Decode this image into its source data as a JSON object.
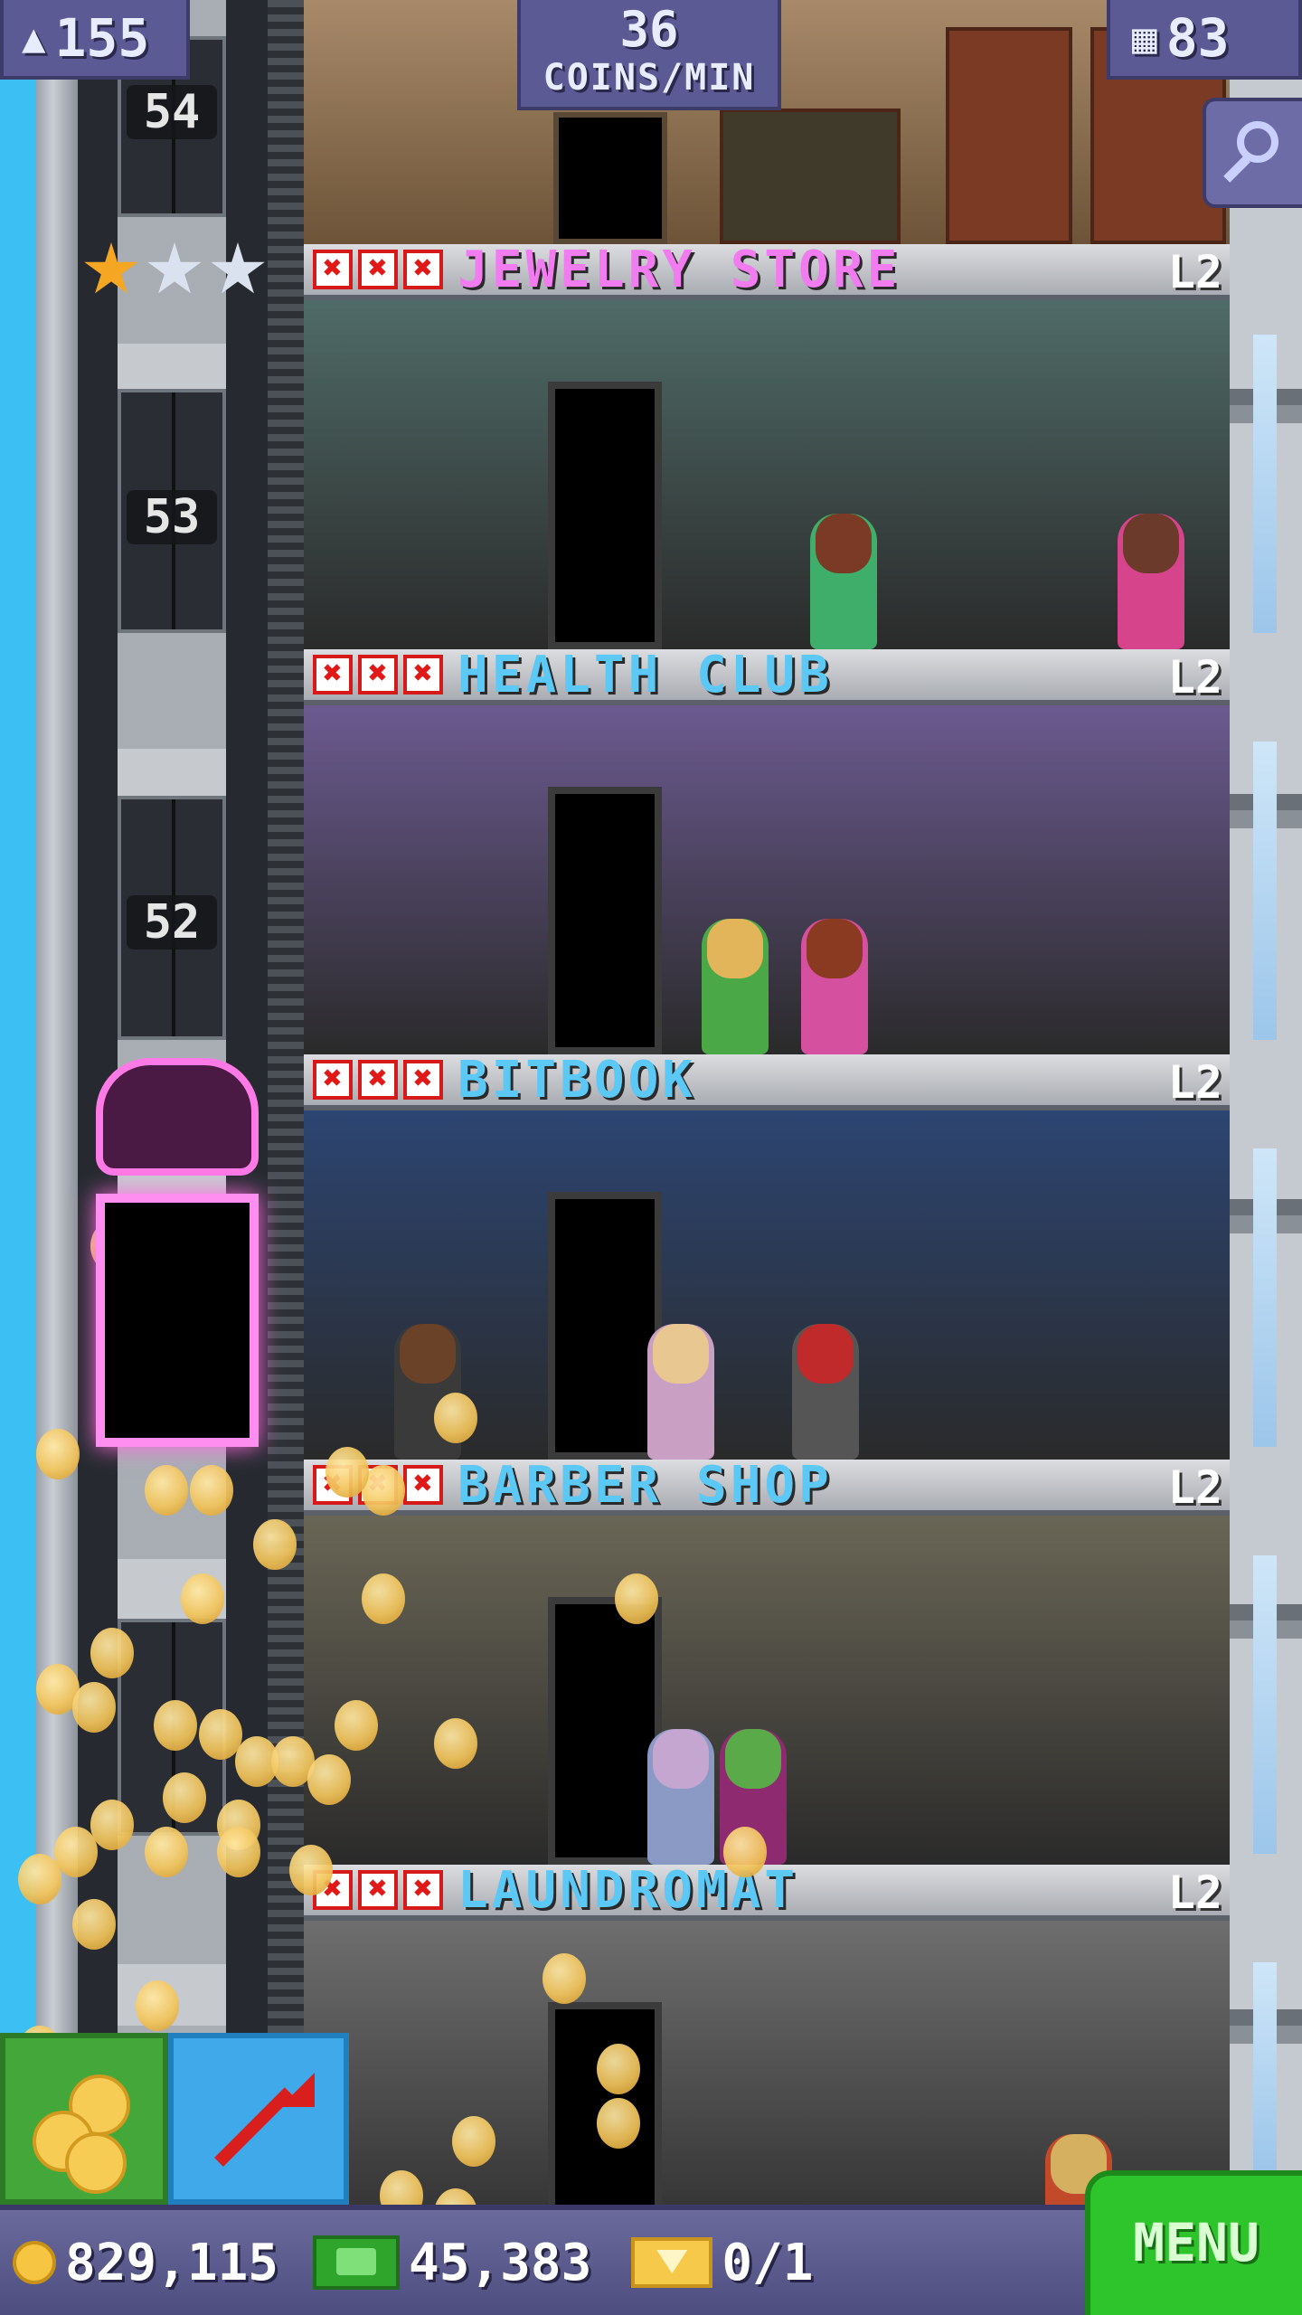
{
  "hud": {
    "population": "155",
    "coins_per_min_value": "36",
    "coins_per_min_label": "COINS/MIN",
    "floors": "83",
    "search_icon": "magnifier-icon"
  },
  "elevator": {
    "floor_numbers": [
      "54",
      "53",
      "52"
    ],
    "stars_filled": 1,
    "stars_total": 3
  },
  "floors": [
    {
      "name": "JEWELRY STORE",
      "level": "L2",
      "name_color": "#f07cf0",
      "stock_marks": 3,
      "wall": "#4f6b67"
    },
    {
      "name": "HEALTH CLUB",
      "level": "L2",
      "name_color": "#5bc8f5",
      "stock_marks": 3,
      "wall": "#6b5a90"
    },
    {
      "name": "BITBOOK",
      "level": "L2",
      "name_color": "#5bc8f5",
      "stock_marks": 3,
      "wall": "#2c4572"
    },
    {
      "name": "BARBER SHOP",
      "level": "L2",
      "name_color": "#5bc8f5",
      "stock_marks": 3,
      "wall": "#6a6656"
    },
    {
      "name": "LAUNDROMAT",
      "level": "L2",
      "name_color": "#5bc8f5",
      "stock_marks": 3,
      "wall": "#6e6e6e"
    }
  ],
  "bottom_bar": {
    "coins": "829,115",
    "bux": "45,383",
    "tickets": "0/1",
    "menu_label": "MENU"
  },
  "colors": {
    "hud_purple": "#5b5a94",
    "menu_green": "#2ec42c",
    "coin_gold": "#f6c643",
    "mark_red": "#d61a1a"
  }
}
